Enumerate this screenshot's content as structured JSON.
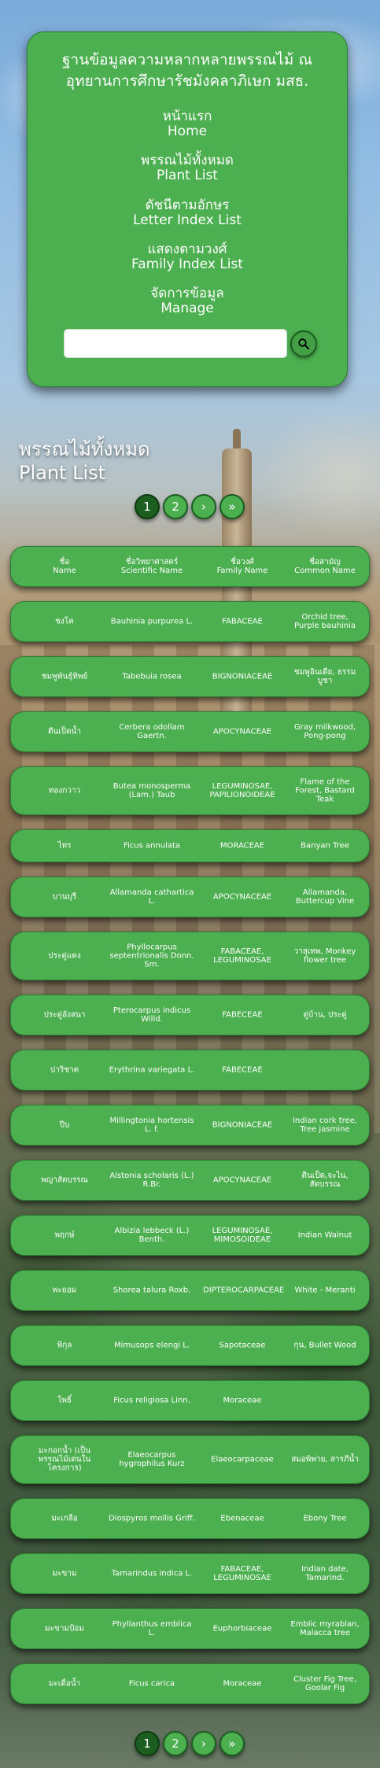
{
  "site": {
    "title_line1": "ฐานข้อมูลความหลากหลายพรรณไม้ ณ",
    "title_line2": "อุทยานการศึกษารัชมังคลาภิเษก มสธ."
  },
  "nav": [
    {
      "th": "หน้าแรก",
      "en": "Home"
    },
    {
      "th": "พรรณไม้ทั้งหมด",
      "en": "Plant List"
    },
    {
      "th": "ดัชนีตามอักษร",
      "en": "Letter Index List"
    },
    {
      "th": "แสดงตามวงศ์",
      "en": "Family Index List"
    },
    {
      "th": "จัดการข้อมูล",
      "en": "Manage"
    }
  ],
  "search": {
    "value": "",
    "icon": "search-icon"
  },
  "page_heading": {
    "th": "พรรณไม้ทั้งหมด",
    "en": "Plant List"
  },
  "pagination": {
    "pages": [
      "1",
      "2"
    ],
    "current": "1",
    "next": "›",
    "last": "»"
  },
  "table": {
    "headers": [
      {
        "th": "ชื่อ",
        "en": "Name"
      },
      {
        "th": "ชื่อวิทยาศาสตร์",
        "en": "Scientific Name"
      },
      {
        "th": "ชื่อวงศ์",
        "en": "Family Name"
      },
      {
        "th": "ชื่อสามัญ",
        "en": "Common Name"
      }
    ],
    "rows": [
      {
        "name": "ชงโค",
        "scientific": "Bauhinia purpurea L.",
        "family": "FABACEAE",
        "common": "Orchid tree, Purple bauhinia"
      },
      {
        "name": "ชมพูพันธุ์ทิพย์",
        "scientific": "Tabebuia rosea",
        "family": "BIGNONIACEAE",
        "common": "ชมพูอินเดีย, ธรรมบูชา"
      },
      {
        "name": "ตีนเป็ดน้ำ",
        "scientific": "Cerbera odollam Gaertn.",
        "family": "APOCYNACEAE",
        "common": "Gray milkwood, Pong-pong"
      },
      {
        "name": "ทองกวาว",
        "scientific": "Butea monosperma (Lam.) Taub",
        "family": "LEGUMINOSAE, PAPILIONOIDEAE",
        "common": "Flame of the Forest, Bastard Teak"
      },
      {
        "name": "ไทร",
        "scientific": "Ficus annulata",
        "family": "MORACEAE",
        "common": "Banyan Tree"
      },
      {
        "name": "บานบุรี",
        "scientific": "Allamanda cathartica L.",
        "family": "APOCYNACEAE",
        "common": "Allamanda, Buttercup Vine"
      },
      {
        "name": "ประดู่แดง",
        "scientific": "Phyllocarpus septentrionalis Donn. Sm.",
        "family": "FABACEAE, LEGUMINOSAE",
        "common": "วาสุเทพ, Monkey flower tree"
      },
      {
        "name": "ประดู่อังสนา",
        "scientific": "Pterocarpus indicus Willd.",
        "family": "FABECEAE",
        "common": "ดู่บ้าน, ประดู่"
      },
      {
        "name": "ปาริชาต",
        "scientific": "Erythrina variegata L.",
        "family": "FABECEAE",
        "common": ""
      },
      {
        "name": "ปีบ",
        "scientific": "Millingtonia hortensis L. f.",
        "family": "BIGNONIACEAE",
        "common": "Indian cork tree, Tree jasmine"
      },
      {
        "name": "พญาสัตบรรณ",
        "scientific": "Alstonia scholaris (L.) R.Br.",
        "family": "APOCYNACEAE",
        "common": "ตีนเป็ด,จะไน, สัตบรรณ"
      },
      {
        "name": "พฤกษ์",
        "scientific": "Albizia lebbeck (L.) Benth.",
        "family": "LEGUMINOSAE, MIMOSOIDEAE",
        "common": "Indian Walnut"
      },
      {
        "name": "พะยอม",
        "scientific": "Shorea talura Roxb.",
        "family": "DIPTEROCARPACEAE",
        "common": "White - Meranti"
      },
      {
        "name": "พิกุล",
        "scientific": "Mimusops elengi L.",
        "family": "Sapotaceae",
        "common": "กุน, Bullet Wood"
      },
      {
        "name": "โพธิ์",
        "scientific": "Ficus religiosa Linn.",
        "family": "Moraceae",
        "common": ""
      },
      {
        "name": "มะกอกน้ำ (เป็นพรรณไม้เด่นในโครงการ)",
        "scientific": "Elaeocarpus hygrophilus Kurz",
        "family": "Elaeocarpaceae",
        "common": "สมอพิพ่าย, สารภีน้ำ"
      },
      {
        "name": "มะเกลือ",
        "scientific": "Diospyros mollis Griff.",
        "family": "Ebenaceae",
        "common": "Ebony Tree"
      },
      {
        "name": "มะขาม",
        "scientific": "Tamarindus indica L.",
        "family": "FABACEAE, LEGUMINOSAE",
        "common": "Indian date, Tamarind."
      },
      {
        "name": "มะขามป้อม",
        "scientific": "Phyllanthus emblica L.",
        "family": "Euphorbiaceae",
        "common": "Emblic myrablan, Malacca tree"
      },
      {
        "name": "มะเดื่อน้ำ",
        "scientific": "Ficus carica",
        "family": "Moraceae",
        "common": "Cluster Fig Tree, Goolar Fig"
      }
    ]
  },
  "colors": {
    "card": "#4caf50",
    "card_border": "#2e7d32",
    "active_page": "#1b5e20"
  }
}
